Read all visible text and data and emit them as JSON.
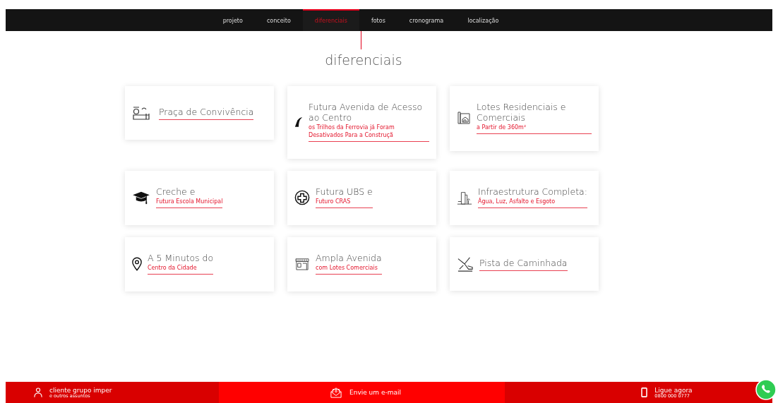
{
  "nav": {
    "tabs": [
      {
        "label": "projeto",
        "selected": false
      },
      {
        "label": "conceito",
        "selected": false
      },
      {
        "label": "diferenciais",
        "selected": true
      },
      {
        "label": "fotos",
        "selected": false
      },
      {
        "label": "cronograma",
        "selected": false
      },
      {
        "label": "localização",
        "selected": false
      }
    ]
  },
  "heading": "diferenciais",
  "cards": [
    {
      "title": "Praça de Convivência"
    },
    {
      "title": "Futura Avenida de Acesso ao Centro",
      "subtitle": "os Trilhos da Ferrovia já Foram Desativados Para a Construçã"
    },
    {
      "title": "Lotes Residenciais e Comerciais",
      "subtitle": "a Partir de 360m²"
    },
    {
      "title": "Creche e",
      "subtitle": "Futura Escola Municipal"
    },
    {
      "title": "Futura UBS e",
      "subtitle": "Futuro CRAS"
    },
    {
      "title": "Infraestrutura Completa:",
      "subtitle": "Água, Luz, Asfalto e Esgoto"
    },
    {
      "title": "A 5 Minutos do",
      "subtitle": "Centro da Cidade"
    },
    {
      "title": "Ampla Avenida",
      "subtitle": "com Lotes Comerciais"
    },
    {
      "title": "Pista de Caminhada"
    }
  ],
  "footer": [
    {
      "title": "cliente grupo imper",
      "subtitle": "e outros assuntos"
    },
    {
      "title": "Envie um e-mail"
    },
    {
      "title": "Ligue agora",
      "subtitle": "0800 000 0777"
    }
  ]
}
